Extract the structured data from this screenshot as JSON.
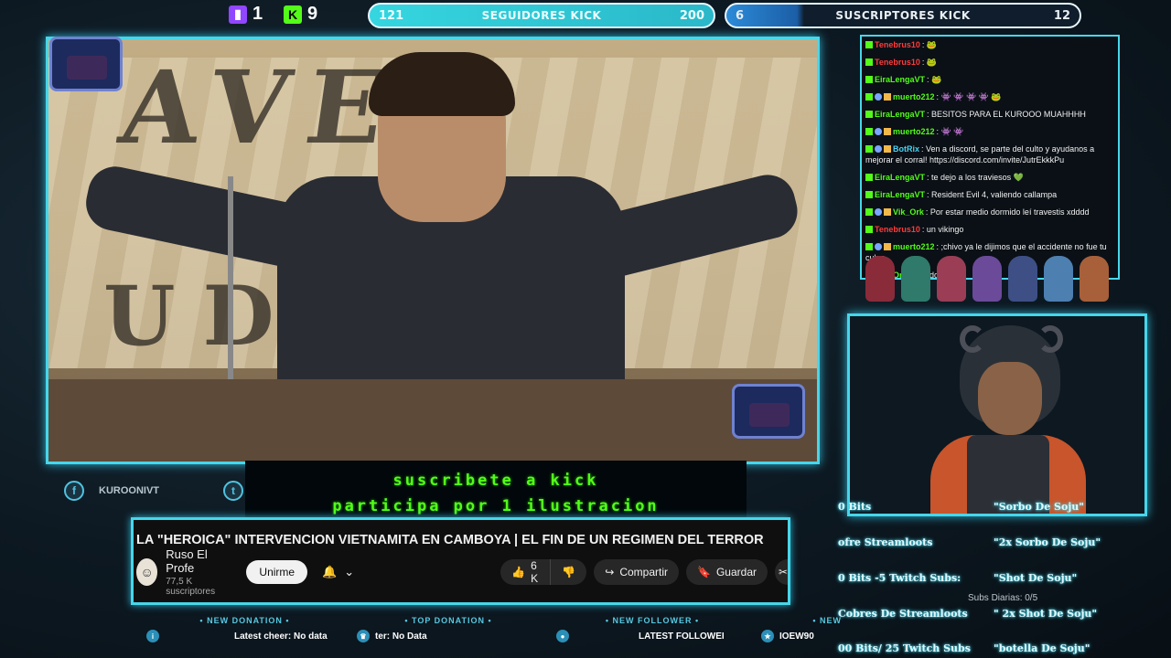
{
  "top": {
    "twitch_count": "1",
    "kick_count": "9",
    "goal_followers": {
      "min": "121",
      "title": "SEGUIDORES KICK",
      "max": "200"
    },
    "goal_subs": {
      "min": "6",
      "title": "SUSCRIPTORES KICK",
      "max": "12"
    }
  },
  "social": {
    "handle": "KUROONIVT"
  },
  "kick_promo": {
    "line1": "suscribete a kick",
    "line2": "participa por 1 ilustracion"
  },
  "youtube": {
    "title": "LA \"HEROICA\" INTERVENCION VIETNAMITA EN CAMBOYA | EL FIN DE UN REGIMEN DEL TERROR",
    "channel_name": "Ruso El Profe",
    "subscribers": "77,5 K suscriptores",
    "join_label": "Unirme",
    "likes": "6 K",
    "share_label": "Compartir",
    "save_label": "Guardar"
  },
  "bottom_bar": [
    {
      "head": "• NEW DONATION •",
      "value": "Latest cheer: No data"
    },
    {
      "head": "• TOP DONATION •",
      "value": "ter: No Data"
    },
    {
      "head": "• NEW FOLLOWER •",
      "value": "LATEST FOLLOWEI"
    },
    {
      "head": "• NEW",
      "value": "IOEW90"
    }
  ],
  "chat": [
    {
      "user": "Tenebrus10",
      "color": "red",
      "badges": [
        "kick"
      ],
      "msg": "🐸"
    },
    {
      "user": "Tenebrus10",
      "color": "red",
      "badges": [
        "kick"
      ],
      "msg": "🐸"
    },
    {
      "user": "EiraLengaVT",
      "color": "green",
      "badges": [
        "kick"
      ],
      "msg": "🐸"
    },
    {
      "user": "muerto212",
      "color": "green",
      "badges": [
        "kick",
        "mod",
        "gift"
      ],
      "msg": "👾 👾 👾 👾 🐸"
    },
    {
      "user": "EiraLengaVT",
      "color": "green",
      "badges": [
        "kick"
      ],
      "msg": "BESITOS PARA EL KUROOO MUAHHHH"
    },
    {
      "user": "muerto212",
      "color": "green",
      "badges": [
        "kick",
        "mod",
        "gift"
      ],
      "msg": "👾 👾"
    },
    {
      "user": "BotRix",
      "color": "cyan",
      "badges": [
        "kick",
        "mod",
        "gift"
      ],
      "msg": "Ven a discord, se parte del culto y ayudanos a mejorar el corral! https://discord.com/invite/JutrEkkkPu"
    },
    {
      "user": "EiraLengaVT",
      "color": "green",
      "badges": [
        "kick"
      ],
      "msg": "te dejo a los traviesos 💚"
    },
    {
      "user": "EiraLengaVT",
      "color": "green",
      "badges": [
        "kick"
      ],
      "msg": "Resident Evil 4, valiendo callampa"
    },
    {
      "user": "Vik_Ork",
      "color": "green",
      "badges": [
        "kick",
        "mod",
        "gift"
      ],
      "msg": "Por estar medio dormido leí travestis xdddd"
    },
    {
      "user": "Tenebrus10",
      "color": "red",
      "badges": [
        "kick"
      ],
      "msg": "un vikingo"
    },
    {
      "user": "muerto212",
      "color": "green",
      "badges": [
        "kick",
        "mod",
        "gift"
      ],
      "msg": ";chivo ya le dijimos que el accidente no fue tu culpa"
    },
    {
      "user": "Ork",
      "color": "green",
      "badges": [
        "kick",
        "mod",
        "gift"
      ],
      "msg": "mundo"
    }
  ],
  "rewards": [
    {
      "cost": "0 Bits",
      "name": "\"Sorbo De Soju\""
    },
    {
      "cost": "ofre Streamloots",
      "name": "\"2x Sorbo De Soju\""
    },
    {
      "cost": "0 Bits -5 Twitch Subs:",
      "name": "\"Shot De Soju\""
    },
    {
      "cost": "Cobres De Streamloots",
      "name": "\" 2x Shot De Soju\""
    },
    {
      "cost": "00 Bits/ 25 Twitch Subs",
      "name": "\"botella De Soju\""
    }
  ],
  "subs_daily": "Subs Diarias: 0/5",
  "colors": {
    "accent": "#47d6ea",
    "kick": "#53fc18",
    "twitch": "#9146ff"
  }
}
